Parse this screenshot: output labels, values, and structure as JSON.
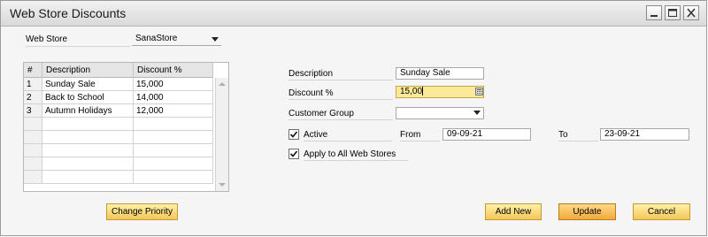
{
  "window": {
    "title": "Web Store Discounts"
  },
  "web_store": {
    "label": "Web Store",
    "value": "SanaStore"
  },
  "grid": {
    "headers": [
      "#",
      "Description",
      "Discount %"
    ],
    "rows": [
      [
        "1",
        "Sunday Sale",
        "15,000"
      ],
      [
        "2",
        "Back to School",
        "14,000"
      ],
      [
        "3",
        "Autumn Holidays",
        "12,000"
      ]
    ]
  },
  "form": {
    "description_label": "Description",
    "description_value": "Sunday Sale",
    "discount_label": "Discount %",
    "discount_value": "15,00",
    "customer_group_label": "Customer Group",
    "customer_group_value": "",
    "active_label": "Active",
    "active_checked": true,
    "from_label": "From",
    "from_value": "09-09-21",
    "to_label": "To",
    "to_value": "23-09-21",
    "apply_all_label": "Apply to All Web Stores",
    "apply_all_checked": true
  },
  "buttons": {
    "change_priority": "Change Priority",
    "add_new": "Add New",
    "update": "Update",
    "cancel": "Cancel"
  },
  "colors": {
    "button_gold": "#f3c65a",
    "focus_field": "#fde99b",
    "titlebar": "#d9d9d9"
  }
}
